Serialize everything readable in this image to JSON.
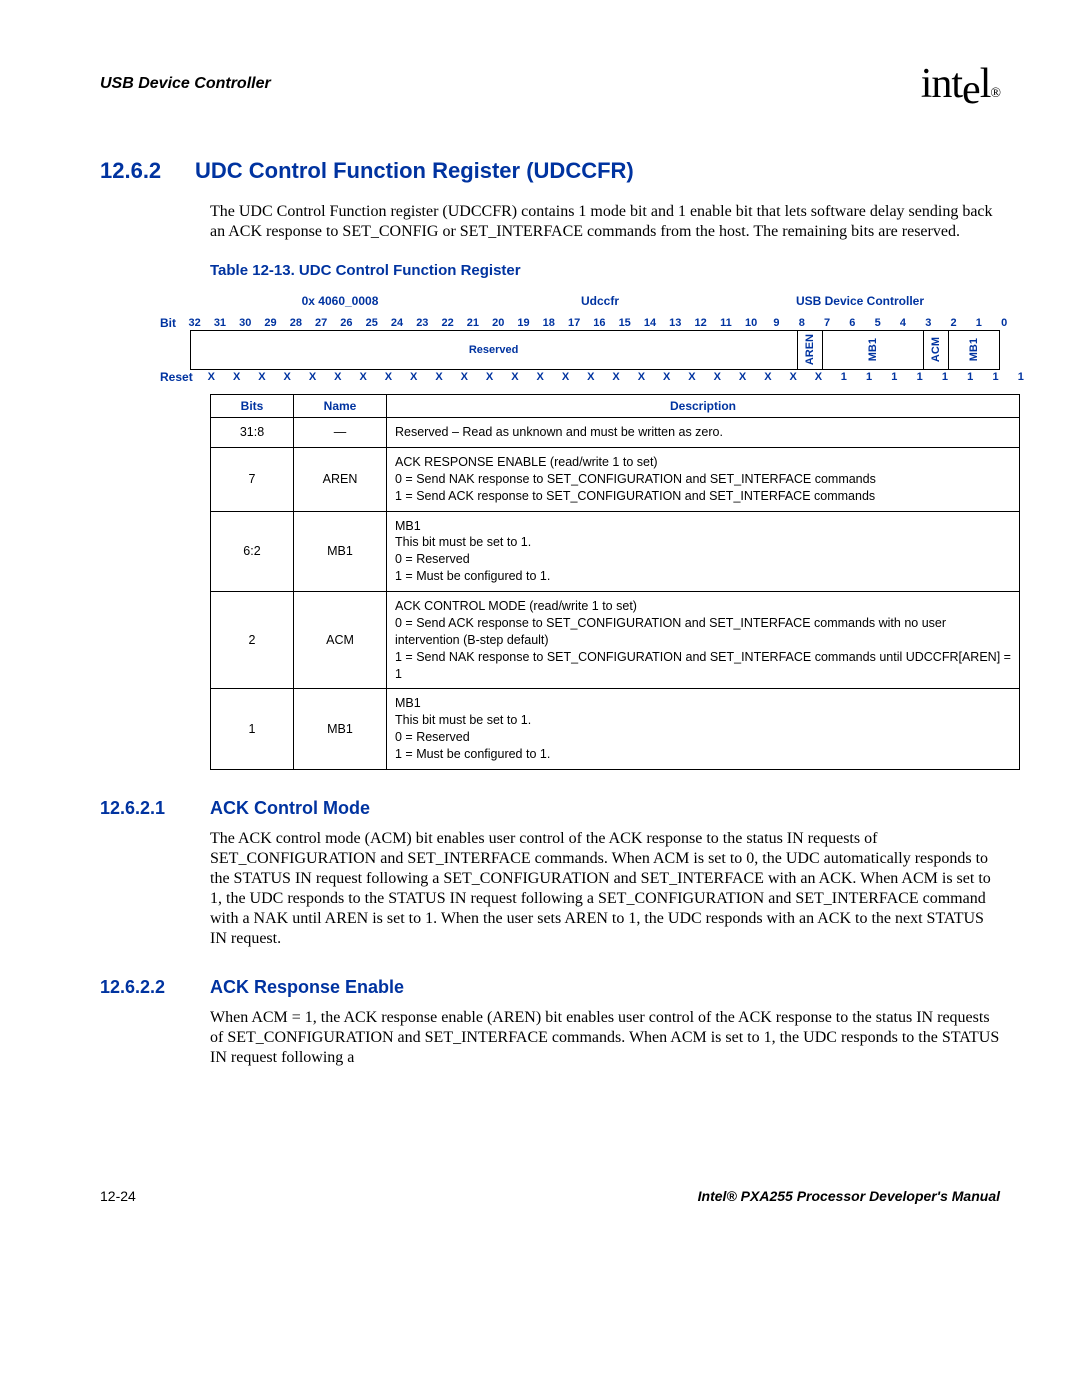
{
  "header": {
    "section_title": "USB Device Controller",
    "logo_text": "intel",
    "logo_sub": "®"
  },
  "section_1262": {
    "number": "12.6.2",
    "title": "UDC Control Function Register (UDCCFR)",
    "paragraph": "The UDC Control Function register (UDCCFR) contains 1 mode bit and 1 enable bit that lets software delay sending back an ACK response to SET_CONFIG or SET_INTERFACE commands from the host. The remaining bits are reserved."
  },
  "table_caption": "Table 12-13. UDC Control Function Register",
  "reg_header": {
    "address": "0x 4060_0008",
    "reg_name": "Udccfr",
    "controller": "USB Device Controller"
  },
  "bit_row_label": "Bit",
  "bits": [
    "32",
    "31",
    "30",
    "29",
    "28",
    "27",
    "26",
    "25",
    "24",
    "23",
    "22",
    "21",
    "20",
    "19",
    "18",
    "17",
    "16",
    "15",
    "14",
    "13",
    "12",
    "11",
    "10",
    "9",
    "8",
    "7",
    "6",
    "5",
    "4",
    "3",
    "2",
    "1",
    "0"
  ],
  "name_row": {
    "reserved": "Reserved",
    "aren": "AREN",
    "mb1a": "MB1",
    "acm": "ACM",
    "mb1b": "MB1"
  },
  "reset_label": "Reset",
  "reset_values": [
    "X",
    "X",
    "X",
    "X",
    "X",
    "X",
    "X",
    "X",
    "X",
    "X",
    "X",
    "X",
    "X",
    "X",
    "X",
    "X",
    "X",
    "X",
    "X",
    "X",
    "X",
    "X",
    "X",
    "X",
    "X",
    "1",
    "1",
    "1",
    "1",
    "1",
    "1",
    "1",
    "1"
  ],
  "desc_headers": {
    "bits": "Bits",
    "name": "Name",
    "desc": "Description"
  },
  "desc_rows": [
    {
      "bits": "31:8",
      "name": "—",
      "desc": "Reserved – Read as unknown and must be written as zero."
    },
    {
      "bits": "7",
      "name": "AREN",
      "desc": "ACK RESPONSE ENABLE (read/write 1 to set)\n0 =  Send NAK response to SET_CONFIGURATION and SET_INTERFACE commands\n1 =  Send ACK response to SET_CONFIGURATION and SET_INTERFACE commands"
    },
    {
      "bits": "6:2",
      "name": "MB1",
      "desc": "MB1\nThis bit must be set to 1.\n0 =  Reserved\n1 =  Must be configured to 1."
    },
    {
      "bits": "2",
      "name": "ACM",
      "desc": "ACK CONTROL MODE (read/write 1 to set)\n0 =  Send ACK response to SET_CONFIGURATION and SET_INTERFACE commands with no user intervention (B-step default)\n1 =  Send NAK response to SET_CONFIGURATION and SET_INTERFACE commands until UDCCFR[AREN] = 1"
    },
    {
      "bits": "1",
      "name": "MB1",
      "desc": "MB1\nThis bit must be set to 1.\n0 =  Reserved\n1 =  Must be configured to 1."
    }
  ],
  "section_12621": {
    "number": "12.6.2.1",
    "title": "ACK Control Mode",
    "paragraph": "The ACK control mode (ACM) bit enables user control of the ACK response to the status IN requests of SET_CONFIGURATION and SET_INTERFACE commands. When ACM is set to 0, the UDC automatically responds to the STATUS IN request following a SET_CONFIGURATION and SET_INTERFACE with an ACK. When ACM is set to 1, the UDC responds to the STATUS IN request following a SET_CONFIGURATION and SET_INTERFACE command with a NAK until AREN is set to 1. When the user sets AREN to 1, the UDC responds with an ACK to the next STATUS IN request."
  },
  "section_12622": {
    "number": "12.6.2.2",
    "title": "ACK Response Enable",
    "paragraph": "When ACM = 1, the ACK response enable (AREN) bit enables user control of the ACK response to the status IN requests of SET_CONFIGURATION and SET_INTERFACE commands. When ACM is set to 1, the UDC responds to the STATUS IN request following a"
  },
  "footer": {
    "page": "12-24",
    "manual": "Intel® PXA255 Processor Developer's Manual"
  }
}
